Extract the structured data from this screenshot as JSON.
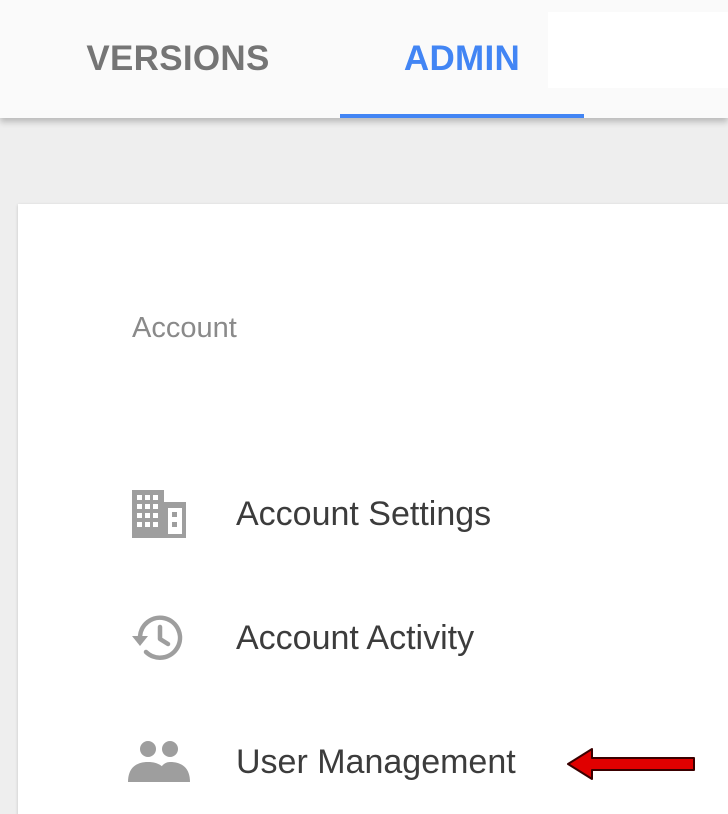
{
  "tabs": {
    "versions": {
      "label": "VERSIONS"
    },
    "admin": {
      "label": "ADMIN",
      "active": true
    }
  },
  "colors": {
    "accent": "#4285f4",
    "annotation_arrow": "#e00000"
  },
  "account": {
    "section_title": "Account",
    "items": [
      {
        "label": "Account Settings",
        "icon": "building-icon"
      },
      {
        "label": "Account Activity",
        "icon": "history-icon"
      },
      {
        "label": "User Management",
        "icon": "users-icon"
      }
    ]
  }
}
